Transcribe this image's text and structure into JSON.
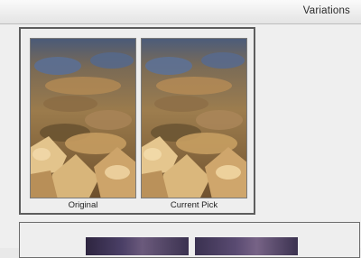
{
  "window": {
    "title": "Variations"
  },
  "variations": {
    "thumbnails": [
      {
        "label": "Original"
      },
      {
        "label": "Current Pick"
      }
    ]
  },
  "colors": {
    "panel_border": "#5d5d5d",
    "background": "#efefef"
  }
}
